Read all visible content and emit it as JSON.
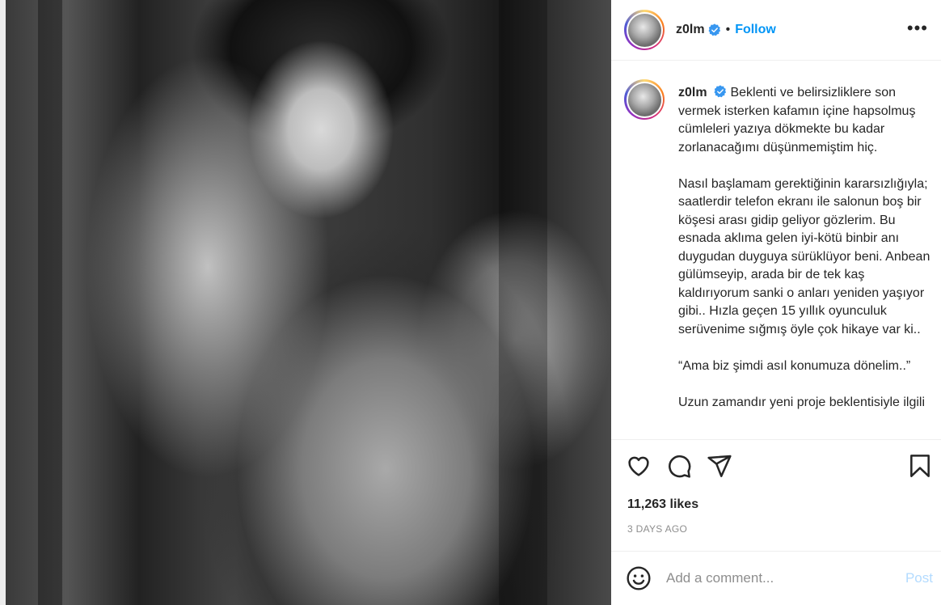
{
  "post": {
    "username": "z0lm",
    "verified": true,
    "separator": "•",
    "follow_label": "Follow",
    "more_label": "•••",
    "caption": "Beklenti ve belirsizliklere son vermek isterken kafamın içine hapsolmuş cümleleri yazıya dökmekte bu kadar zorlanacağımı düşünmemiştim hiç.\n\nNasıl başlamam gerektiğinin kararsızlığıyla; saatlerdir telefon ekranı ile salonun boş bir köşesi arası gidip geliyor gözlerim. Bu esnada aklıma gelen iyi-kötü binbir anı duygudan duyguya sürüklüyor beni. Anbean gülümseyip, arada bir de tek kaş kaldırıyorum sanki o anları yeniden yaşıyor gibi.. Hızla geçen 15 yıllık oyunculuk serüvenime sığmış öyle çok hikaye var ki..\n\n“Ama biz şimdi asıl konumuza dönelim..”\n\nUzun zamandır yeni proje beklentisiyle ilgili",
    "likes": "11,263 likes",
    "time": "3 DAYS AGO"
  },
  "comment": {
    "placeholder": "Add a comment...",
    "post_label": "Post"
  },
  "icons": {
    "like": "heart-icon",
    "comment": "comment-icon",
    "share": "share-icon",
    "save": "bookmark-icon",
    "emoji": "emoji-icon",
    "verified": "verified-badge-icon",
    "more": "more-options-icon"
  },
  "colors": {
    "accent": "#0095f6",
    "verified": "#3897f0",
    "post_disabled": "#b3dbff",
    "muted": "#8e8e8e"
  }
}
